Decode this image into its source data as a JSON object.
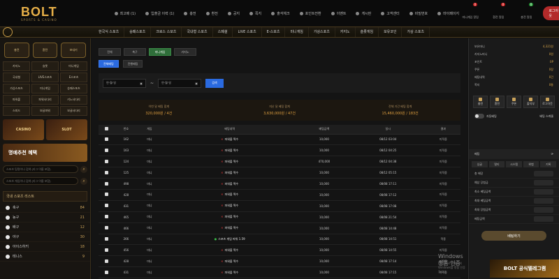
{
  "logo": {
    "main": "BOLT",
    "sub": "SPORTS & CASINO"
  },
  "toplinks": [
    "최고배 (1)",
    "입출금 이력 (1)",
    "충전",
    "환전",
    "공지",
    "쪽지",
    "출석체크",
    "포인트전환",
    "이벤트",
    "게시판",
    "고객센터",
    "비밀번호",
    "마이페이지"
  ],
  "topright": [
    {
      "label": "미니게임 알림",
      "badge": "0"
    },
    {
      "label": "환전 알림",
      "badge": "0"
    },
    {
      "label": "충전 알림",
      "badge": "0"
    }
  ],
  "logout_label": "로그아웃",
  "nav": [
    "한국식 스포츠",
    "승패스포츠",
    "크로스 스포츠",
    "국내형 스포츠",
    "스페셜",
    "LIVE 스포츠",
    "E-스포츠",
    "미니게임",
    "가상스포츠",
    "카지노",
    "슬롯게임",
    "보유코인",
    "가상 스포츠"
  ],
  "sidebar": {
    "quick": [
      "충전",
      "환전",
      "보내기"
    ],
    "menu": [
      "카지노",
      "슬롯",
      "미니게임",
      "국내형",
      "LIVE스포츠",
      "E스포츠",
      "가상스포츠",
      "미니게임",
      "승패스포츠",
      "파워볼",
      "파워사다리",
      "키노사다리",
      "스피드",
      "보글파워",
      "보글사다리"
    ],
    "banners": [
      "CASINO",
      "SLOT"
    ],
    "promo": "명예추천 혜택",
    "search1": "스포츠 팀명이나 검색 (리그 이름 포함)",
    "search2": "스포츠 게임이나 검색 (리그 이름 포함)",
    "sports_head": "국내 스포츠 리스트",
    "sports": [
      {
        "name": "축구",
        "count": "84"
      },
      {
        "name": "농구",
        "count": "21"
      },
      {
        "name": "배구",
        "count": "12"
      },
      {
        "name": "야구",
        "count": "30"
      },
      {
        "name": "아이스하키",
        "count": "18"
      },
      {
        "name": "테니스",
        "count": "9"
      }
    ]
  },
  "main": {
    "tabs": [
      "전체",
      "축구",
      "미니게임",
      "카지노"
    ],
    "subtabs": [
      "전체베팅",
      "진행베팅"
    ],
    "date_from": "연-월-일",
    "date_to": "연-월-일",
    "search_label": "검색",
    "stats": [
      {
        "label": "이번 달 베팅 합계",
        "value": "320,000원 / 4건"
      },
      {
        "label": "지난 달 베팅 합계",
        "value": "3,630,000원 / 47건"
      },
      {
        "label": "전체 기간 베팅 합계",
        "value": "15,460,000원 / 183건"
      }
    ],
    "columns": [
      "",
      "번호",
      "게임",
      "베팅내역",
      "베팅금액",
      "일시",
      "결과"
    ],
    "rows": [
      {
        "no": "162",
        "game": "미니",
        "pick": "파워볼 짝수",
        "ok": false,
        "amount": "10,000",
        "date": "08/12 03:04",
        "result": "미적중"
      },
      {
        "no": "163",
        "game": "미니",
        "pick": "파워볼 짝수",
        "ok": false,
        "amount": "10,000",
        "date": "08/12 04:25",
        "result": "미적중"
      },
      {
        "no": "124",
        "game": "미니",
        "pick": "파워볼 짝수",
        "ok": false,
        "amount": "470,000",
        "date": "08/12 04:38",
        "result": "미적중"
      },
      {
        "no": "125",
        "game": "미니",
        "pick": "파워볼 짝수",
        "ok": false,
        "amount": "10,000",
        "date": "08/12 05:15",
        "result": "미적중"
      },
      {
        "no": "498",
        "game": "미니",
        "pick": "파워볼 짝수",
        "ok": false,
        "amount": "10,000",
        "date": "08/08 17:11",
        "result": "미적중"
      },
      {
        "no": "428",
        "game": "미니",
        "pick": "파워볼 짝수",
        "ok": false,
        "amount": "10,000",
        "date": "08/08 17:12",
        "result": "미적중"
      },
      {
        "no": "431",
        "game": "미니",
        "pick": "파워볼 짝수",
        "ok": false,
        "amount": "10,000",
        "date": "08/08 17:08",
        "result": "미적중"
      },
      {
        "no": "465",
        "game": "미니",
        "pick": "파워볼 짝수",
        "ok": false,
        "amount": "10,000",
        "date": "08/08 21:54",
        "result": "미적중"
      },
      {
        "no": "466",
        "game": "미니",
        "pick": "파워볼 짝수",
        "ok": false,
        "amount": "10,000",
        "date": "08/08 14:48",
        "result": "미적중"
      },
      {
        "no": "266",
        "game": "미니",
        "pick": "스포츠 게임 파워 1.59",
        "ok": true,
        "amount": "10,000",
        "date": "08/08 14:51",
        "result": "적중"
      },
      {
        "no": "456",
        "game": "미니",
        "pick": "파워볼 짝수",
        "ok": false,
        "amount": "10,000",
        "date": "08/08 14:55",
        "result": "미적중"
      },
      {
        "no": "428",
        "game": "미니",
        "pick": "파워볼 짝수",
        "ok": false,
        "amount": "10,000",
        "date": "08/08 17:14",
        "result": "미적중"
      },
      {
        "no": "431",
        "game": "미니",
        "pick": "파워볼 짝수",
        "ok": false,
        "amount": "10,000",
        "date": "08/08 17:15",
        "result": "미적중"
      }
    ],
    "watermark": "Windows 정품 인증",
    "watermark_sub": "[설정]으로 이동하여 Windows를 정품 인증합니다."
  },
  "rightbar": {
    "user": [
      {
        "label": "보유머니",
        "value": "4,321원"
      },
      {
        "label": "카지노머니",
        "value": "0원"
      },
      {
        "label": "포인트",
        "value": "0P"
      },
      {
        "label": "쿠폰",
        "value": "0장"
      },
      {
        "label": "베팅내역",
        "value": "0건"
      },
      {
        "label": "쪽지",
        "value": "0통"
      }
    ],
    "buttons": [
      "충전",
      "환전",
      "쿠폰",
      "출석부",
      "로그아웃"
    ],
    "toggle_label": "자동베팅",
    "toggle_right": "배팅 스케줄",
    "slip_head": "베팅",
    "slip_tabs": [
      "싱글",
      "멀티",
      "시스템",
      "위험",
      "기록"
    ],
    "slip_rows": [
      "총 배당",
      "예상 당첨금",
      "최소 베팅금액",
      "최대 베팅금액",
      "최대 당첨금액",
      "베팅금액"
    ],
    "slip_button": "베팅하기",
    "banner": "BOLT 공식텔레그램"
  }
}
